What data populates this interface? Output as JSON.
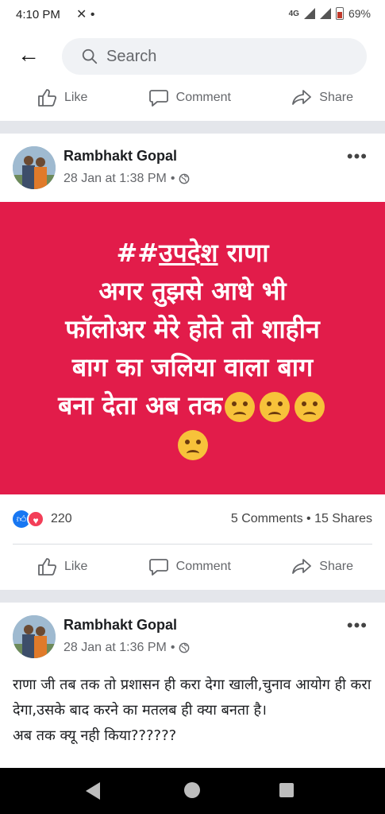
{
  "status_bar": {
    "time": "4:10 PM",
    "left_icons": "✕ •",
    "network": "4G",
    "battery_percent": "69%"
  },
  "search": {
    "placeholder": "Search"
  },
  "actions": {
    "like": "Like",
    "comment": "Comment",
    "share": "Share"
  },
  "post1": {
    "author": "Rambhakt Gopal",
    "timestamp": "28 Jan at 1:38 PM",
    "separator": "•",
    "image_text": {
      "hash_prefix": "##",
      "hash_word": "उपदेश",
      "line1_rest": " राणा",
      "line2": "अगर तुझसे आधे भी",
      "line3": "फॉलोअर मेरे होते तो शाहीन",
      "line4": "बाग का जलिया वाला बाग",
      "line5": "बना देता अब तक"
    },
    "reaction_count": "220",
    "comments_shares": "5 Comments • 15 Shares"
  },
  "post2": {
    "author": "Rambhakt Gopal",
    "timestamp": "28 Jan at 1:36 PM",
    "separator": "•",
    "text_line1": "राणा जी तब तक तो प्रशासन ही करा देगा खाली,चुनाव आयोग ही करा देगा,उसके बाद करने का मतलब ही क्या बनता है।",
    "text_line2": "अब तक क्यू नही किया??????"
  },
  "colors": {
    "card_red": "#e21c4a",
    "like_blue": "#1877f2",
    "love_red": "#f33e58"
  }
}
